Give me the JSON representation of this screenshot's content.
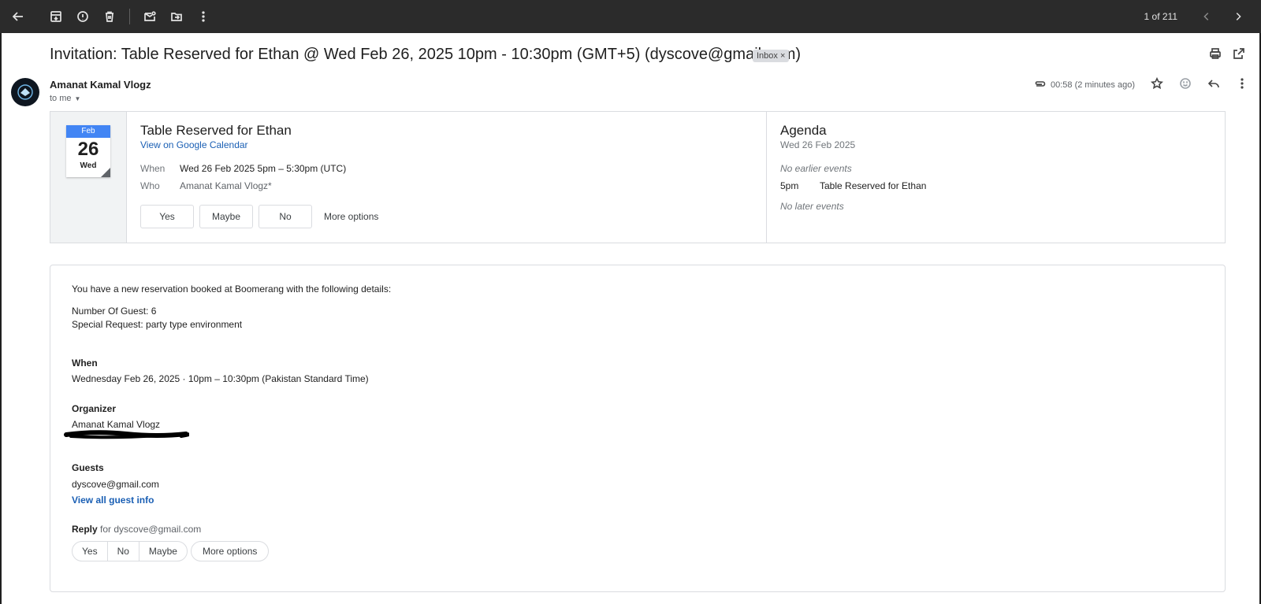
{
  "toolbar": {
    "pager": "1 of 211"
  },
  "message": {
    "subject": "Invitation: Table Reserved for Ethan @ Wed Feb 26, 2025 10pm - 10:30pm (GMT+5) (dyscove@gmail.com)",
    "label_chip": "Inbox ×",
    "sender": "Amanat Kamal Vlogz",
    "to": "to me",
    "time": "00:58 (2 minutes ago)"
  },
  "calendar": {
    "month": "Feb",
    "day": "26",
    "weekday": "Wed",
    "event_title": "Table Reserved for Ethan",
    "view_link": "View on Google Calendar",
    "when_label": "When",
    "when_value": "Wed 26 Feb 2025 5pm – 5:30pm (UTC)",
    "who_label": "Who",
    "who_value": "Amanat Kamal Vlogz*",
    "rsvp_yes": "Yes",
    "rsvp_maybe": "Maybe",
    "rsvp_no": "No",
    "more_options": "More options"
  },
  "agenda": {
    "title": "Agenda",
    "date": "Wed 26 Feb 2025",
    "no_earlier": "No earlier events",
    "event_time": "5pm",
    "event_name": "Table Reserved for Ethan",
    "no_later": "No later events"
  },
  "body": {
    "intro": "You have a new reservation booked at Boomerang with the following details:",
    "guests_count": "Number Of Guest: 6",
    "special_request": "Special Request: party type environment",
    "when_heading": "When",
    "when_value": "Wednesday Feb 26, 2025 · 10pm – 10:30pm (Pakistan Standard Time)",
    "organizer_heading": "Organizer",
    "organizer_value": "Amanat Kamal Vlogz",
    "guests_heading": "Guests",
    "guest_email": "dyscove@gmail.com",
    "view_guests": "View all guest info",
    "reply_label": "Reply",
    "reply_for": "for dyscove@gmail.com",
    "reply_yes": "Yes",
    "reply_no": "No",
    "reply_maybe": "Maybe",
    "reply_more": "More options"
  }
}
